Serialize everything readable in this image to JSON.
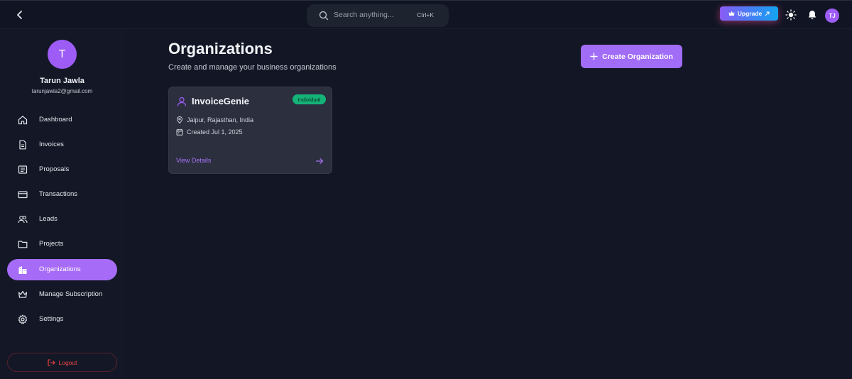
{
  "header": {
    "search_placeholder": "Search anything...",
    "search_shortcut": "Ctrl+K",
    "upgrade_label": "Upgrade",
    "avatar_initials": "TJ"
  },
  "profile": {
    "initial": "T",
    "name": "Tarun Jawla",
    "email": "tarunjawla2@gmail.com"
  },
  "sidebar": {
    "items": [
      {
        "label": "Dashboard",
        "icon": "home-icon"
      },
      {
        "label": "Invoices",
        "icon": "document-icon"
      },
      {
        "label": "Proposals",
        "icon": "list-icon"
      },
      {
        "label": "Transactions",
        "icon": "card-icon"
      },
      {
        "label": "Leads",
        "icon": "users-icon"
      },
      {
        "label": "Projects",
        "icon": "folder-icon"
      },
      {
        "label": "Organizations",
        "icon": "building-icon",
        "active": true
      },
      {
        "label": "Manage Subscription",
        "icon": "crown-icon"
      },
      {
        "label": "Settings",
        "icon": "gear-icon"
      }
    ],
    "logout_label": "Logout"
  },
  "main": {
    "title": "Organizations",
    "subtitle": "Create and manage your business organizations",
    "create_label": "Create Organization",
    "organizations": [
      {
        "name": "InvoiceGenie",
        "type": "Individual",
        "location": "Jaipur, Rajasthan, India",
        "created": "Created Jul 1, 2025",
        "link_label": "View Details"
      }
    ]
  },
  "colors": {
    "accent": "#a16cf6",
    "badge": "#14b378",
    "logout": "#ef4444",
    "background": "#121625"
  }
}
